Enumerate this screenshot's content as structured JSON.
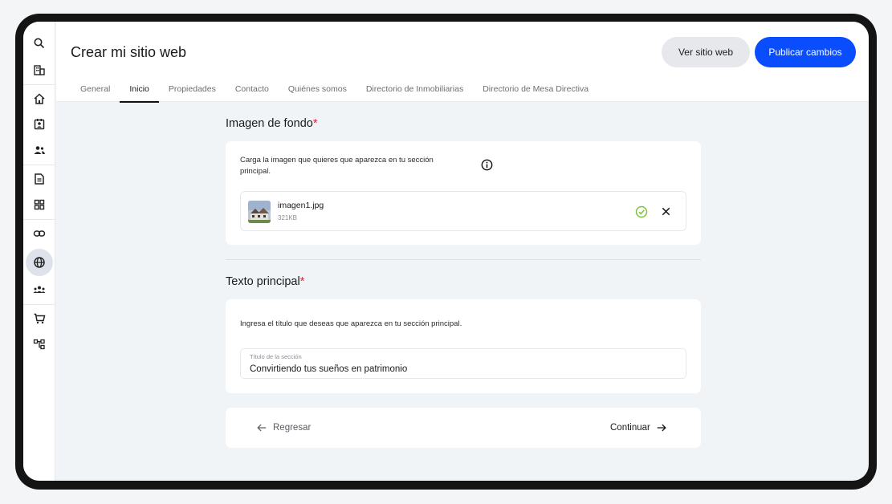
{
  "header": {
    "title": "Crear mi sitio web",
    "view_site_label": "Ver sitio web",
    "publish_label": "Publicar cambios"
  },
  "tabs": [
    {
      "label": "General"
    },
    {
      "label": "Inicio",
      "active": true
    },
    {
      "label": "Propiedades"
    },
    {
      "label": "Contacto"
    },
    {
      "label": "Quiénes somos"
    },
    {
      "label": "Directorio de Inmobiliarias"
    },
    {
      "label": "Directorio de Mesa Directiva"
    }
  ],
  "sidebar": {
    "items": [
      {
        "icon": "search-icon"
      },
      {
        "icon": "building-icon"
      },
      {
        "icon": "home-icon"
      },
      {
        "icon": "contact-card-icon"
      },
      {
        "icon": "users-icon"
      },
      {
        "icon": "document-icon"
      },
      {
        "icon": "grid-icon"
      },
      {
        "icon": "link-icon"
      },
      {
        "icon": "globe-icon",
        "active": true
      },
      {
        "icon": "team-icon"
      },
      {
        "icon": "cart-icon"
      },
      {
        "icon": "hierarchy-icon"
      }
    ]
  },
  "background_image": {
    "title": "Imagen de fondo",
    "required_mark": "*",
    "description": "Carga la imagen que quieres que aparezca en tu sección principal.",
    "file_name": "imagen1.jpg",
    "file_size": "321KB"
  },
  "main_text": {
    "title": "Texto principal",
    "required_mark": "*",
    "description": "Ingresa el título que deseas que aparezca en tu sección principal.",
    "field_label": "Título de la sección",
    "field_value": "Convirtiendo tus sueños en patrimonio"
  },
  "footer_nav": {
    "back_label": "Regresar",
    "next_label": "Continuar"
  },
  "colors": {
    "primary": "#0a4dff",
    "required": "#e0203a",
    "success": "#7cc43a"
  }
}
